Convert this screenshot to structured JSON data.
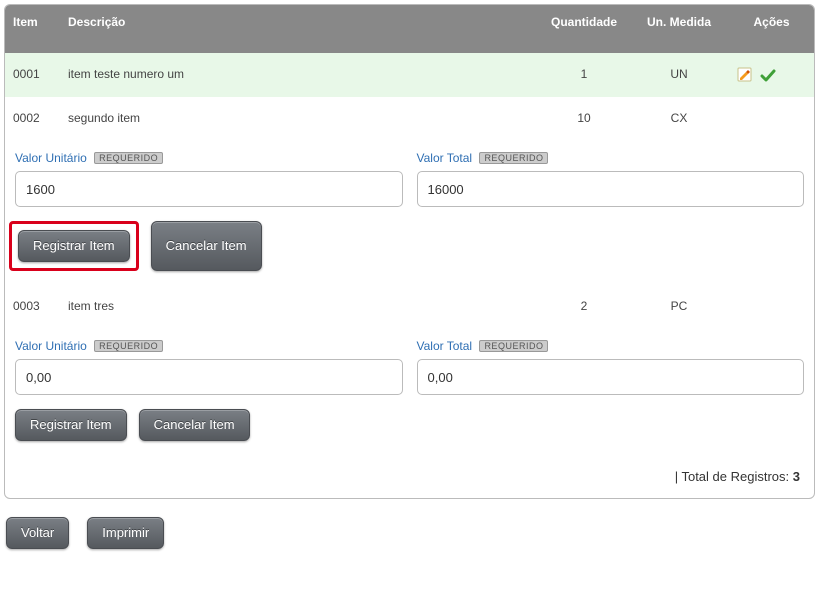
{
  "headers": {
    "item": "Item",
    "descricao": "Descrição",
    "quantidade": "Quantidade",
    "un_medida": "Un. Medida",
    "acoes": "Ações"
  },
  "rows": [
    {
      "item": "0001",
      "descricao": "item teste numero um",
      "quantidade": "1",
      "un_medida": "UN",
      "has_actions": true
    },
    {
      "item": "0002",
      "descricao": "segundo item",
      "quantidade": "10",
      "un_medida": "CX",
      "has_actions": false
    },
    {
      "item": "0003",
      "descricao": "item tres",
      "quantidade": "2",
      "un_medida": "PC",
      "has_actions": false
    }
  ],
  "labels": {
    "valor_unitario": "Valor Unitário",
    "valor_total": "Valor Total",
    "requerido": "REQUERIDO",
    "registrar_item": "Registrar Item",
    "cancelar_item": "Cancelar Item",
    "voltar": "Voltar",
    "imprimir": "Imprimir",
    "total_registros_label": "Total de Registros:"
  },
  "forms": [
    {
      "valor_unitario": "1600",
      "valor_total": "16000",
      "highlight_register": true
    },
    {
      "valor_unitario": "0,00",
      "valor_total": "0,00",
      "highlight_register": false
    }
  ],
  "total_registros": "3",
  "icons": {
    "edit": "edit-icon",
    "confirm": "check-icon"
  }
}
